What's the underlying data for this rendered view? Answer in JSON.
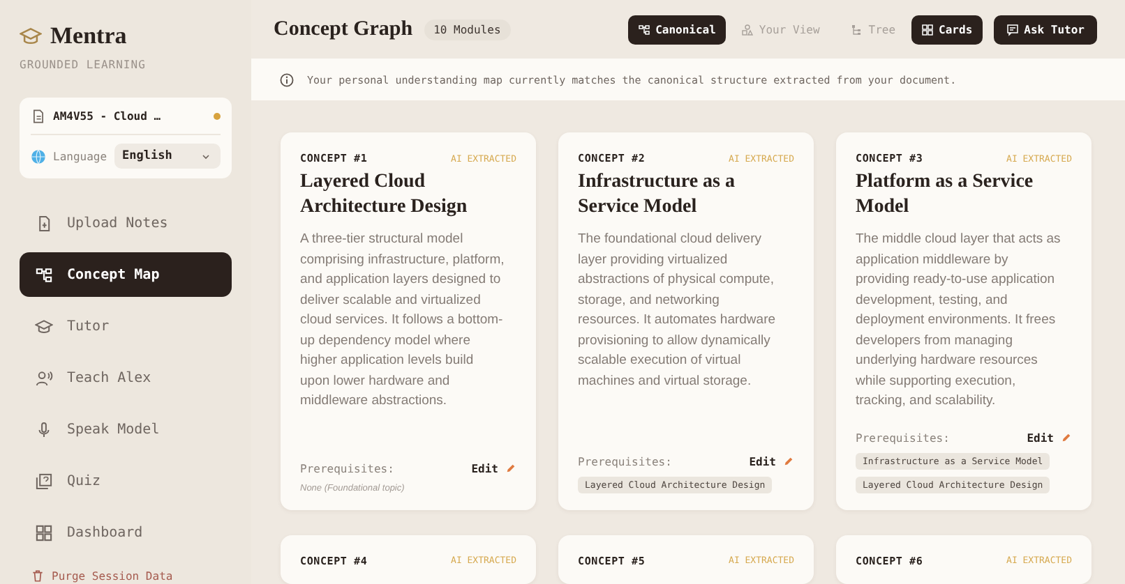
{
  "brand": {
    "name": "Mentra",
    "tagline": "GROUNDED LEARNING"
  },
  "session": {
    "document": "AM4V55 - Cloud …",
    "language_label": "Language",
    "language": "English"
  },
  "nav": [
    {
      "label": "Upload Notes",
      "kind": "upload",
      "selected": false
    },
    {
      "label": "Concept Map",
      "kind": "map",
      "selected": true
    },
    {
      "label": "Tutor",
      "kind": "cap",
      "selected": false
    },
    {
      "label": "Teach Alex",
      "kind": "person",
      "selected": false
    },
    {
      "label": "Speak Model",
      "kind": "mic",
      "selected": false
    },
    {
      "label": "Quiz",
      "kind": "quiz",
      "selected": false
    },
    {
      "label": "Dashboard",
      "kind": "grid",
      "selected": false
    }
  ],
  "purge": "Purge Session Data",
  "header": {
    "title": "Concept Graph",
    "badge": "10 Modules",
    "map_toggle": [
      {
        "label": "Canonical",
        "kind": "map",
        "selected": true
      },
      {
        "label": "Your View",
        "kind": "shapes",
        "selected": false
      }
    ],
    "view_toggle": [
      {
        "label": "Tree",
        "kind": "tree",
        "selected": false
      },
      {
        "label": "Cards",
        "kind": "grid",
        "selected": true
      }
    ],
    "ask": "Ask Tutor"
  },
  "notice": "Your personal understanding map currently matches the canonical structure extracted from your document.",
  "cards": [
    {
      "number": "CONCEPT #1",
      "tag": "AI EXTRACTED",
      "title": "Layered Cloud Architecture Design",
      "description": "A three-tier structural model comprising infrastructure, platform, and application layers designed to deliver scalable and virtualized cloud services. It follows a bottom-up dependency model where higher application levels build upon lower hardware and middleware abstractions.",
      "prereq_label": "Prerequisites:",
      "edit": "Edit",
      "none_note": "None (Foundational topic)"
    },
    {
      "number": "CONCEPT #2",
      "tag": "AI EXTRACTED",
      "title": "Infrastructure as a Service Model",
      "description": "The foundational cloud delivery layer providing virtualized abstractions of physical compute, storage, and networking resources. It automates hardware provisioning to allow dynamically scalable execution of virtual machines and virtual storage.",
      "prereq_label": "Prerequisites:",
      "edit": "Edit",
      "prerequisites": [
        "Layered Cloud Architecture Design"
      ]
    },
    {
      "number": "CONCEPT #3",
      "tag": "AI EXTRACTED",
      "title": "Platform as a Service Model",
      "description": "The middle cloud layer that acts as application middleware by providing ready-to-use application development, testing, and deployment environments. It frees developers from managing underlying hardware resources while supporting execution, tracking, and scalability.",
      "prereq_label": "Prerequisites:",
      "edit": "Edit",
      "prerequisites": [
        "Infrastructure as a Service Model",
        "Layered Cloud Architecture Design"
      ]
    },
    {
      "number": "CONCEPT #4",
      "tag": "AI EXTRACTED"
    },
    {
      "number": "CONCEPT #5",
      "tag": "AI EXTRACTED"
    },
    {
      "number": "CONCEPT #6",
      "tag": "AI EXTRACTED"
    }
  ]
}
